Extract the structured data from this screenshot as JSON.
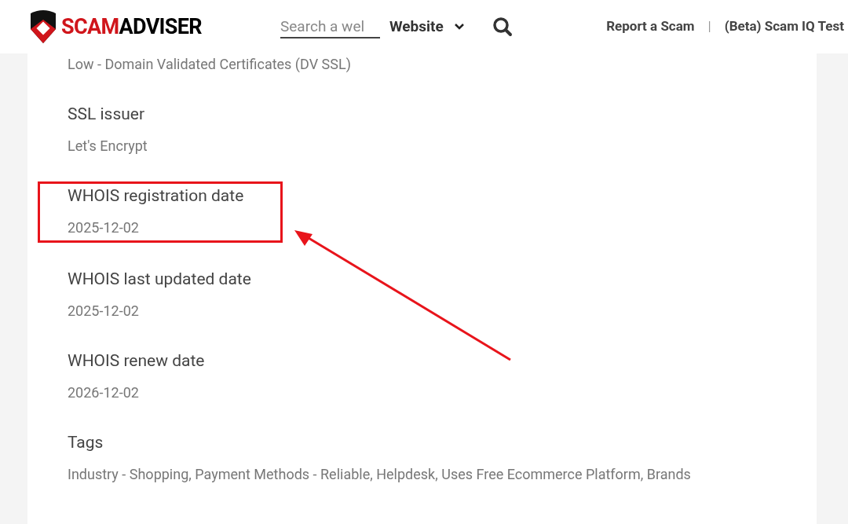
{
  "header": {
    "logo": {
      "part_1": "SCAM",
      "part_2": "ADVISER"
    },
    "search": {
      "placeholder": "Search a wel"
    },
    "search_type": "Website",
    "nav_links": [
      "Report a Scam",
      "(Beta) Scam IQ Test"
    ],
    "separator": "|"
  },
  "details": [
    {
      "value": "Low - Domain Validated Certificates (DV SSL)",
      "highlighted": false
    },
    {
      "label": "SSL issuer",
      "value": "Let's Encrypt",
      "highlighted": false
    },
    {
      "label": "WHOIS registration date",
      "value": "2025-12-02",
      "highlighted": true
    },
    {
      "label": "WHOIS last updated date",
      "value": "2025-12-02",
      "highlighted": false
    },
    {
      "label": "WHOIS renew date",
      "value": "2026-12-02",
      "highlighted": false
    },
    {
      "label": "Tags",
      "value": "Industry - Shopping, Payment Methods - Reliable, Helpdesk, Uses Free Ecommerce Platform, Brands",
      "highlighted": false
    }
  ]
}
